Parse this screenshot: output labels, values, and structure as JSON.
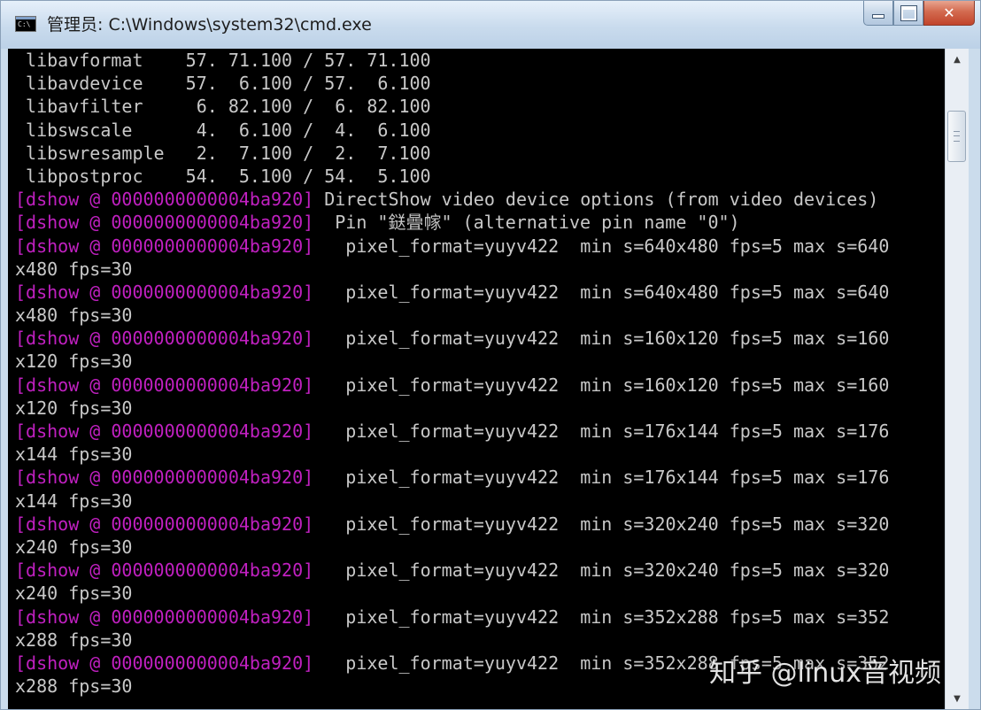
{
  "window": {
    "title": "管理员: C:\\Windows\\system32\\cmd.exe",
    "icon": "cmd-icon",
    "controls": {
      "minimize": "minimize-icon",
      "maximize": "maximize-icon",
      "close": "✕"
    }
  },
  "console": {
    "lines": [
      {
        "prefix": "",
        "text": " libavformat    57. 71.100 / 57. 71.100"
      },
      {
        "prefix": "",
        "text": " libavdevice    57.  6.100 / 57.  6.100"
      },
      {
        "prefix": "",
        "text": " libavfilter     6. 82.100 /  6. 82.100"
      },
      {
        "prefix": "",
        "text": " libswscale      4.  6.100 /  4.  6.100"
      },
      {
        "prefix": "",
        "text": " libswresample   2.  7.100 /  2.  7.100"
      },
      {
        "prefix": "",
        "text": " libpostproc    54.  5.100 / 54.  5.100"
      },
      {
        "prefix": "[dshow @ 0000000000004ba920] ",
        "text": "DirectShow video device options (from video devices)"
      },
      {
        "prefix": "[dshow @ 0000000000004ba920] ",
        "text": " Pin \"鎹曡幏\" (alternative pin name \"0\")"
      },
      {
        "prefix": "[dshow @ 0000000000004ba920] ",
        "text": "  pixel_format=yuyv422  min s=640x480 fps=5 max s=640"
      },
      {
        "prefix": "",
        "text": "x480 fps=30"
      },
      {
        "prefix": "[dshow @ 0000000000004ba920] ",
        "text": "  pixel_format=yuyv422  min s=640x480 fps=5 max s=640"
      },
      {
        "prefix": "",
        "text": "x480 fps=30"
      },
      {
        "prefix": "[dshow @ 0000000000004ba920] ",
        "text": "  pixel_format=yuyv422  min s=160x120 fps=5 max s=160"
      },
      {
        "prefix": "",
        "text": "x120 fps=30"
      },
      {
        "prefix": "[dshow @ 0000000000004ba920] ",
        "text": "  pixel_format=yuyv422  min s=160x120 fps=5 max s=160"
      },
      {
        "prefix": "",
        "text": "x120 fps=30"
      },
      {
        "prefix": "[dshow @ 0000000000004ba920] ",
        "text": "  pixel_format=yuyv422  min s=176x144 fps=5 max s=176"
      },
      {
        "prefix": "",
        "text": "x144 fps=30"
      },
      {
        "prefix": "[dshow @ 0000000000004ba920] ",
        "text": "  pixel_format=yuyv422  min s=176x144 fps=5 max s=176"
      },
      {
        "prefix": "",
        "text": "x144 fps=30"
      },
      {
        "prefix": "[dshow @ 0000000000004ba920] ",
        "text": "  pixel_format=yuyv422  min s=320x240 fps=5 max s=320"
      },
      {
        "prefix": "",
        "text": "x240 fps=30"
      },
      {
        "prefix": "[dshow @ 0000000000004ba920] ",
        "text": "  pixel_format=yuyv422  min s=320x240 fps=5 max s=320"
      },
      {
        "prefix": "",
        "text": "x240 fps=30"
      },
      {
        "prefix": "[dshow @ 0000000000004ba920] ",
        "text": "  pixel_format=yuyv422  min s=352x288 fps=5 max s=352"
      },
      {
        "prefix": "",
        "text": "x288 fps=30"
      },
      {
        "prefix": "[dshow @ 0000000000004ba920] ",
        "text": "  pixel_format=yuyv422  min s=352x288 fps=5 max s=352"
      },
      {
        "prefix": "",
        "text": "x288 fps=30"
      }
    ]
  },
  "scrollbar": {
    "up": "▲",
    "down": "▼"
  },
  "watermark": "知乎 @linux音视频",
  "colors": {
    "background": "#000000",
    "text": "#c8c8c8",
    "prefix": "#c020c0"
  }
}
